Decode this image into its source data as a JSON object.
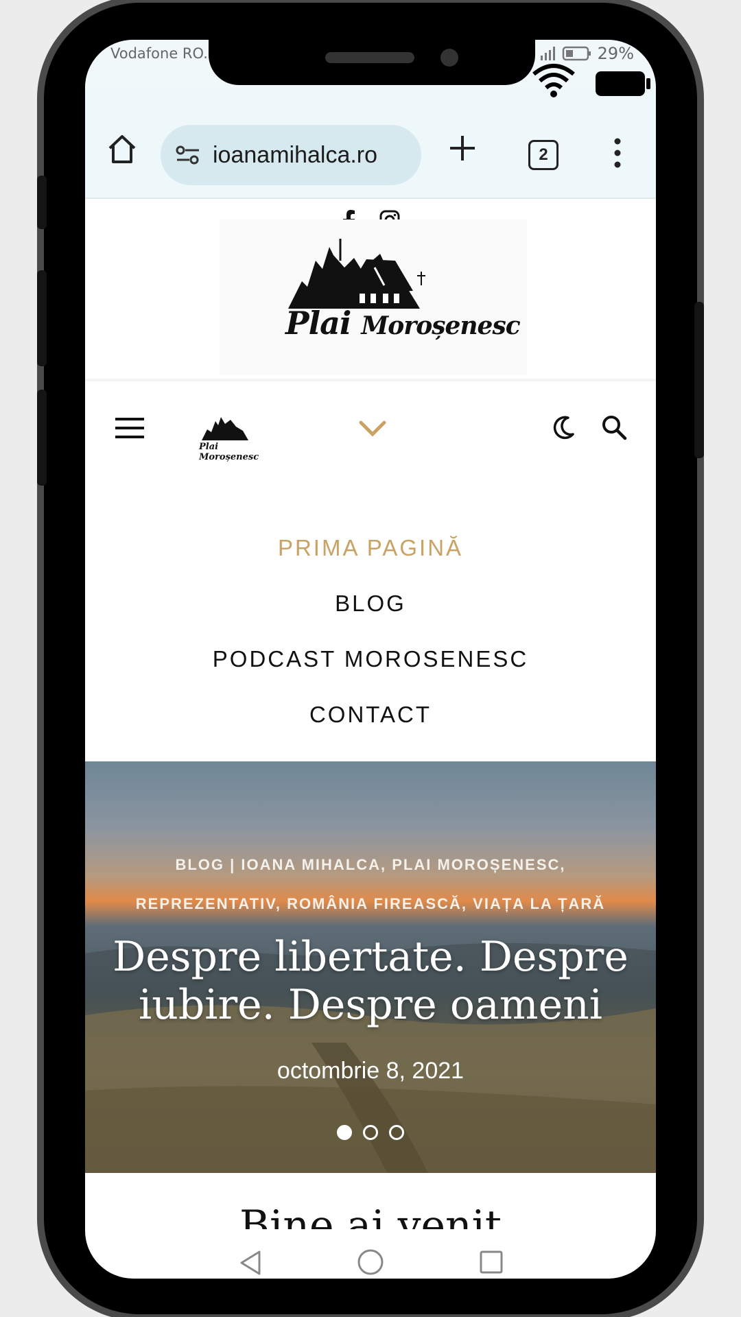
{
  "status_bar": {
    "carrier": "Vodafone RO...",
    "battery": "29%"
  },
  "browser": {
    "url": "ioanamihalca.ro",
    "tab_count": "2"
  },
  "site": {
    "logo_text_main": "Plai",
    "logo_text_sub": "Moroșenesc",
    "mini_logo_text": "Plai Moroșenesc"
  },
  "nav": {
    "items": [
      {
        "label": "PRIMA PAGINĂ",
        "active": true
      },
      {
        "label": "BLOG",
        "active": false
      },
      {
        "label": "PODCAST MOROSENESC",
        "active": false
      },
      {
        "label": "CONTACT",
        "active": false
      }
    ]
  },
  "hero": {
    "categories_line1": "BLOG | IOANA MIHALCA, PLAI MOROȘENESC,",
    "categories_line2": "REPREZENTATIV, ROMÂNIA FIREASCĂ, VIAȚA LA ȚARĂ",
    "title_line1": "Despre libertate. Despre",
    "title_line2": "iubire. Despre oameni",
    "date": "octombrie 8, 2021",
    "slide_count": 3,
    "active_slide": 1
  },
  "welcome_heading": "Bine ai venit",
  "colors": {
    "accent": "#c9a264",
    "browser_bg": "#eef7fa",
    "url_pill": "#d6e9ee"
  }
}
